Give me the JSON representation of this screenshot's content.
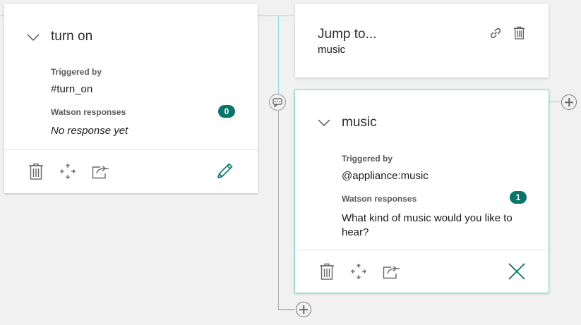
{
  "node_turn_on": {
    "title": "turn on",
    "triggered_label": "Triggered by",
    "trigger_value": "#turn_on",
    "responses_label": "Watson responses",
    "responses_count": "0",
    "response_text": "No response yet"
  },
  "node_jump": {
    "title": "Jump to...",
    "target": "music"
  },
  "node_music": {
    "title": "music",
    "triggered_label": "Triggered by",
    "trigger_value": "@appliance:music",
    "responses_label": "Watson responses",
    "responses_count": "1",
    "response_text": "What kind of music would you like to hear?"
  },
  "colors": {
    "accent": "#08756a",
    "connector": "#93dcd0",
    "background": "#f1f1f1"
  },
  "icons": [
    "chevron-down-icon",
    "trash-icon",
    "move-icon",
    "export-icon",
    "edit-icon",
    "link-icon",
    "close-icon",
    "chat-icon",
    "plus-circle-icon"
  ]
}
